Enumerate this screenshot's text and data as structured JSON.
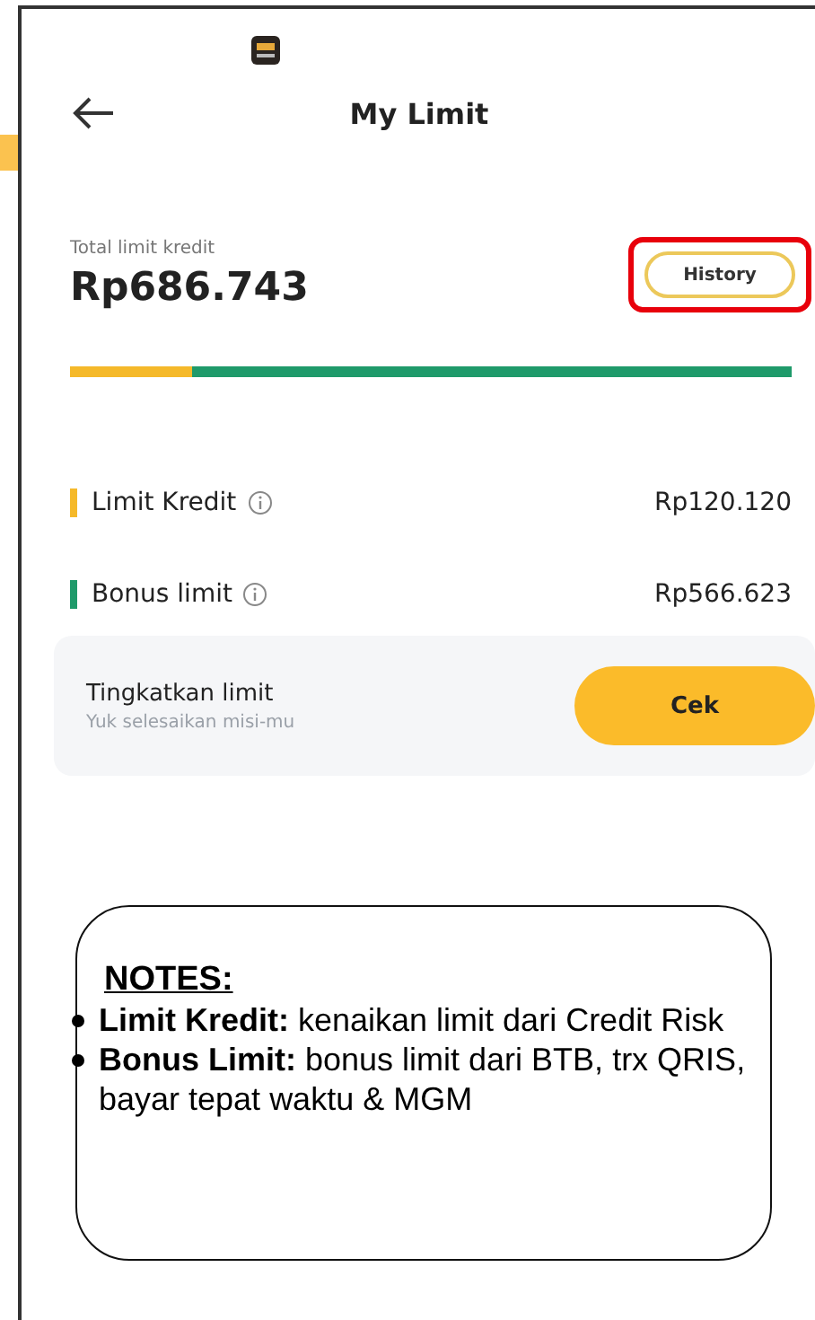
{
  "header": {
    "title": "My Limit"
  },
  "summary": {
    "label": "Total limit kredit",
    "amount": "Rp686.743",
    "history_button": {
      "label": "History",
      "highlighted": true
    }
  },
  "limit_bar": {
    "level": 0.17
  },
  "limits": [
    {
      "label": "Limit Kredit",
      "value": "Rp120.120",
      "color": "#f5b92a"
    },
    {
      "label": "Bonus limit",
      "value": "Rp566.623",
      "color": "#1f9a6a"
    }
  ],
  "upgrade_card": {
    "title": "Tingkatkan limit",
    "subtitle": "Yuk selesaikan misi-mu",
    "button": "Cek"
  },
  "notes": {
    "heading": "NOTES:",
    "items": [
      "**Limit Kredit:** kenaikan limit dari Credit Risk",
      "**Bonus Limit:** bonus limit dari BTB, trx QRIS, bayar tepat waktu & MGM"
    ]
  }
}
